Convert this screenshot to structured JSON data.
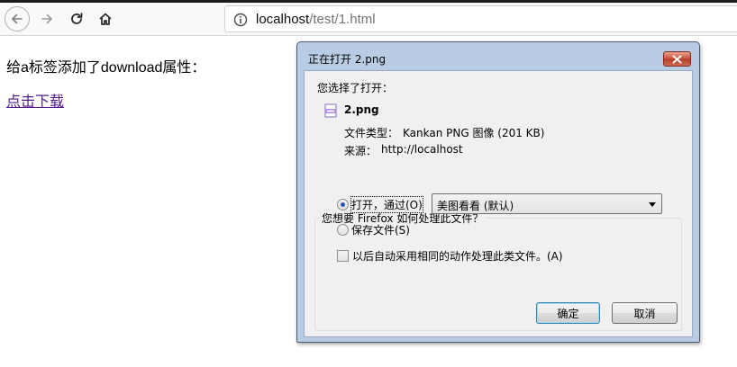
{
  "browser": {
    "url_host": "localhost",
    "url_path": "/test/1.html"
  },
  "page": {
    "text": "给a标签添加了download属性：",
    "link": "点击下载"
  },
  "dialog": {
    "title": "正在打开 2.png",
    "you_chose_label": "您选择了打开：",
    "filename": "2.png",
    "file_type_label": "文件类型：",
    "file_type_value": "Kankan PNG 图像 (201 KB)",
    "source_label": "来源：",
    "source_value": "http://localhost",
    "question": "您想要 Firefox 如何处理此文件？",
    "open_with_label": "打开，通过(O)",
    "open_with_selected": "美图看看 (默认)",
    "save_file_label": "保存文件(S)",
    "auto_checkbox_label": "以后自动采用相同的动作处理此类文件。(A)",
    "ok_label": "确定",
    "cancel_label": "取消"
  },
  "colors": {
    "link_visited": "#551a8b",
    "dialog_frame": "#b8cde3",
    "close_button": "#c7503c"
  },
  "icons": [
    "back-arrow-icon",
    "forward-arrow-icon",
    "reload-icon",
    "home-icon",
    "info-icon",
    "png-file-icon",
    "close-x-icon",
    "chevron-down-icon"
  ]
}
